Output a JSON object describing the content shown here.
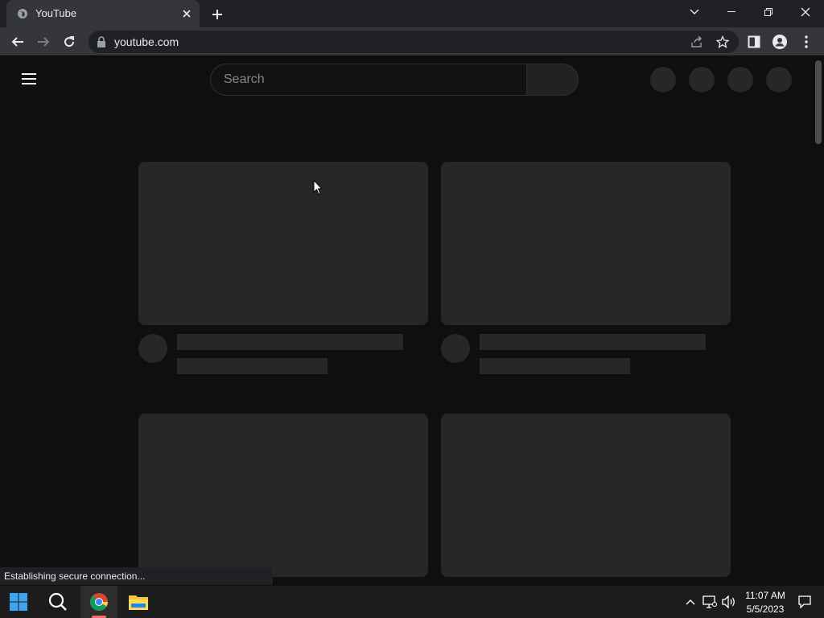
{
  "browser": {
    "tab_title": "YouTube",
    "url": "youtube.com",
    "status": "Establishing secure connection..."
  },
  "youtube": {
    "search_placeholder": "Search"
  },
  "taskbar": {
    "time": "11:07 AM",
    "date": "5/5/2023"
  },
  "colors": {
    "accent": "#ff6b6b",
    "skeleton": "#272727",
    "page_bg": "#0f0f0f"
  }
}
